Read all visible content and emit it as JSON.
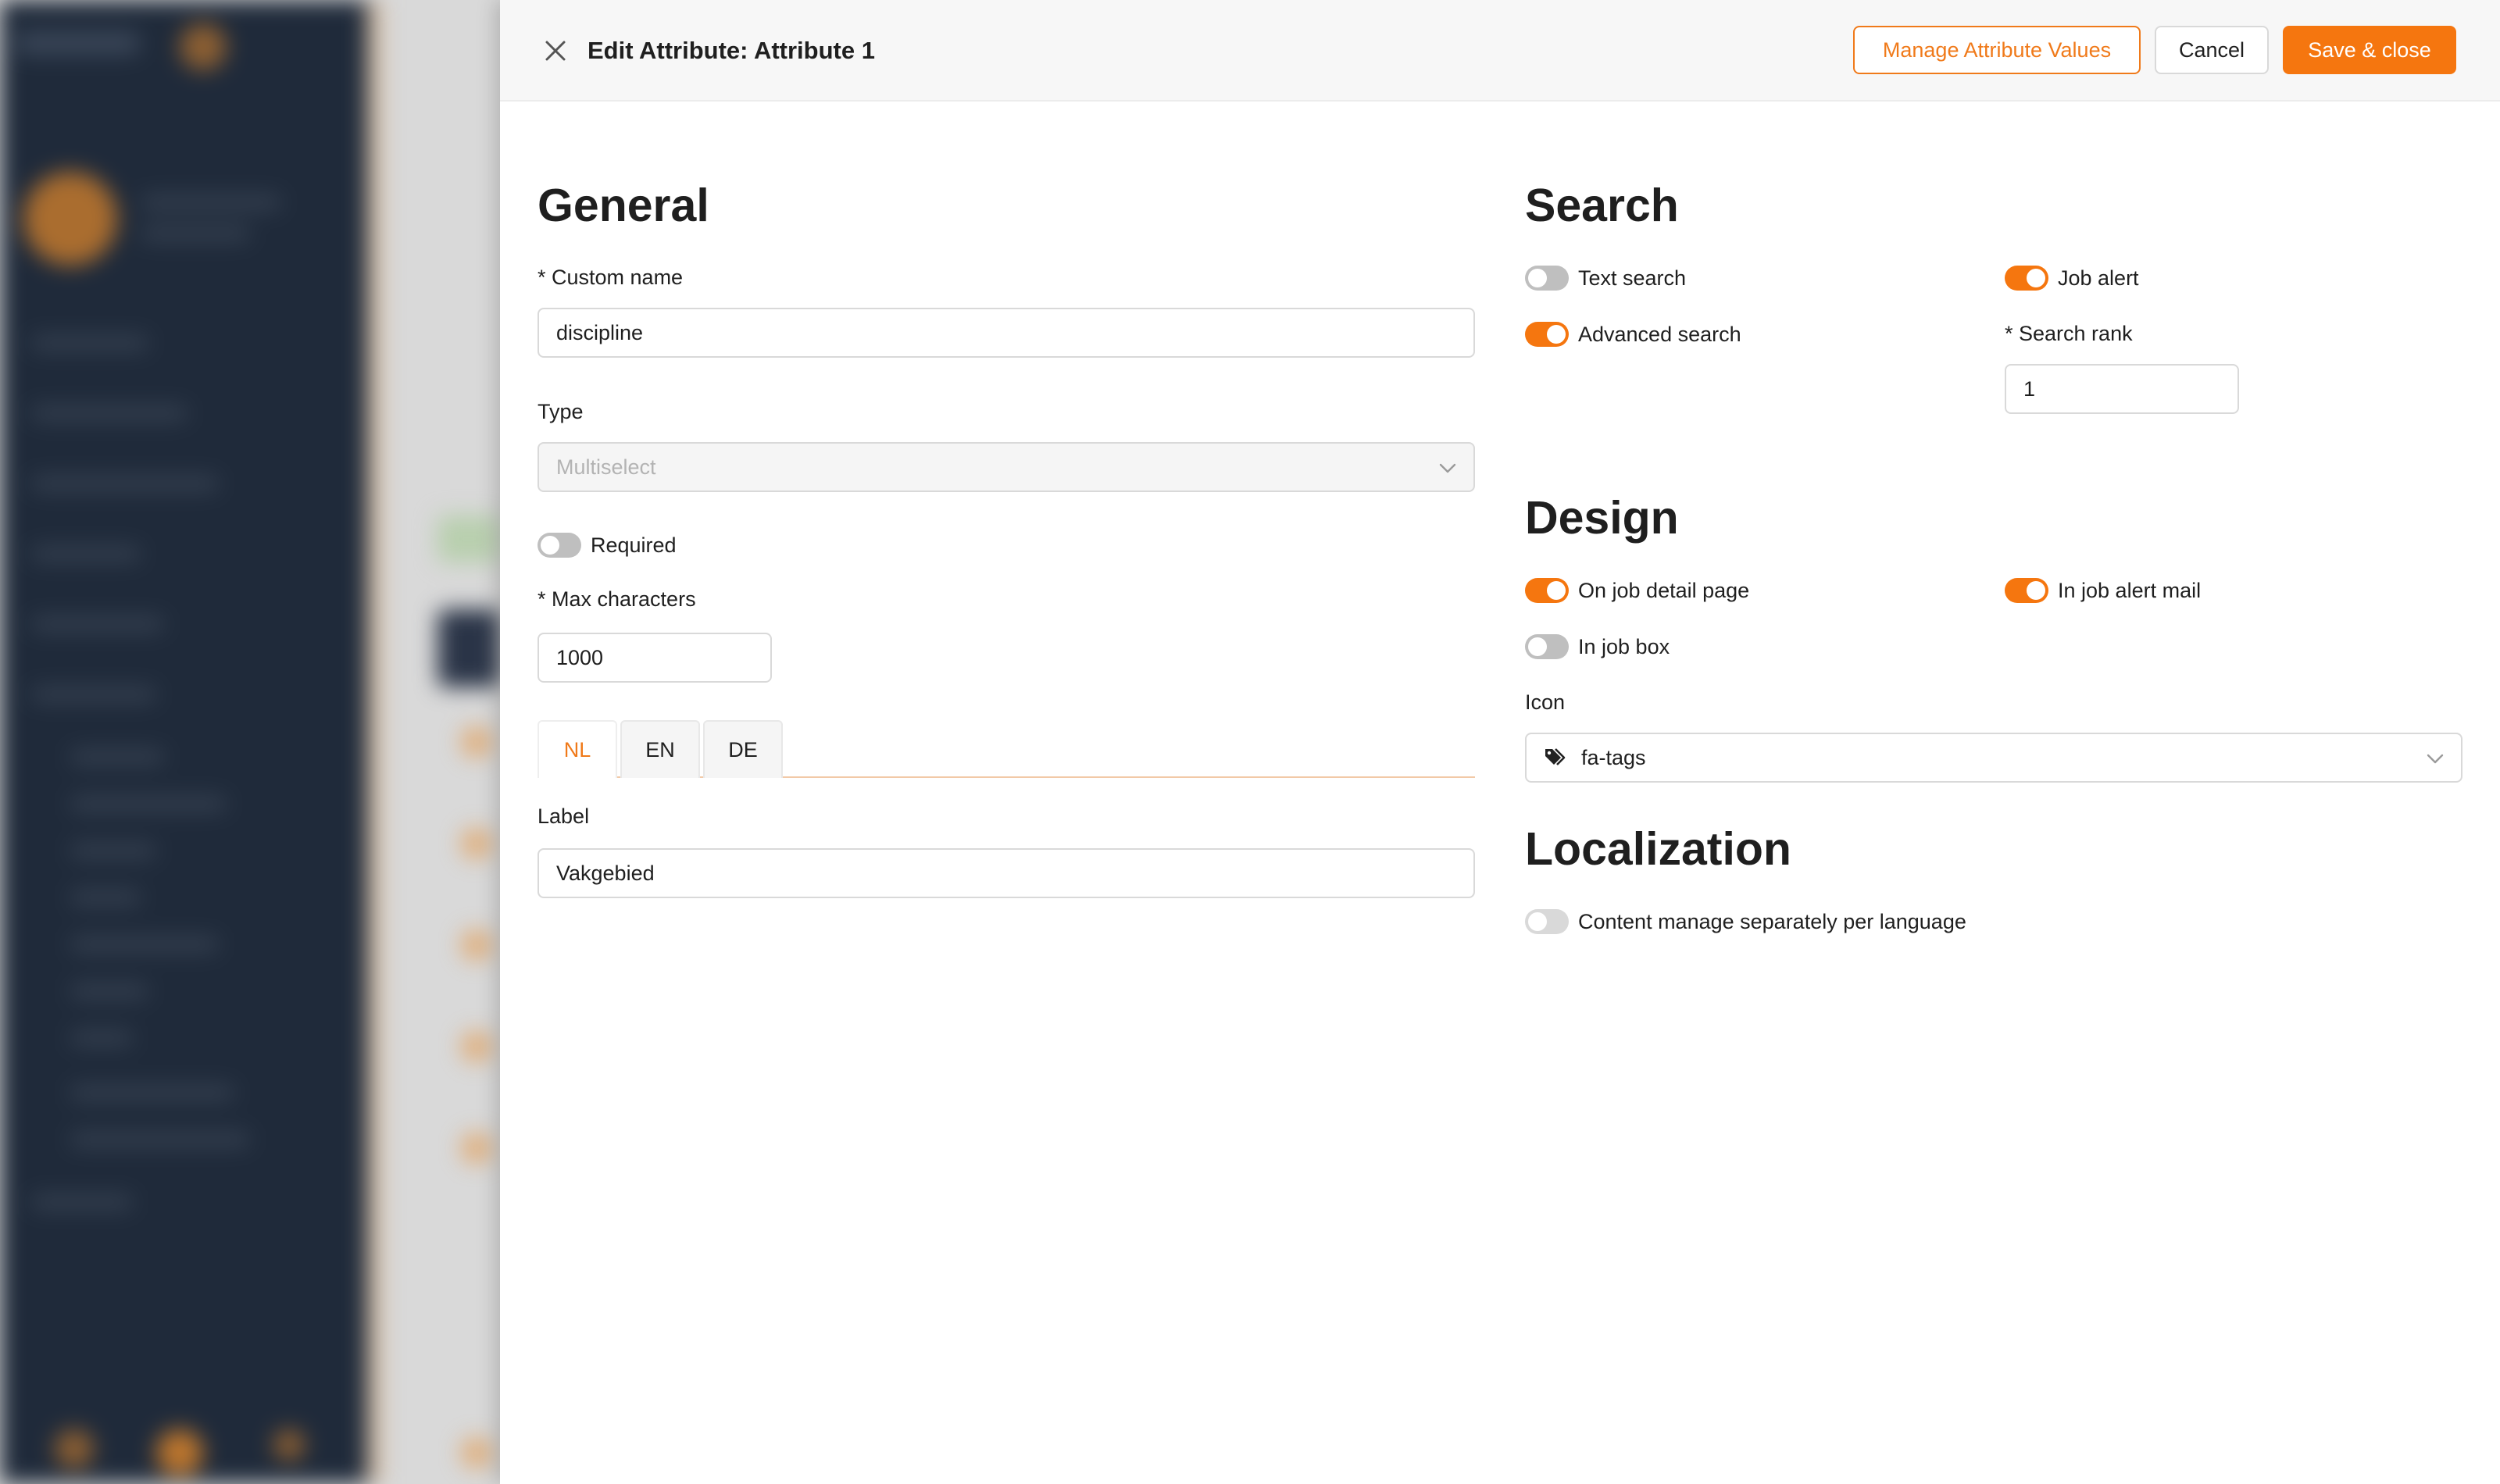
{
  "header": {
    "title": "Edit Attribute: Attribute 1",
    "manage_values_label": "Manage Attribute Values",
    "cancel_label": "Cancel",
    "save_label": "Save & close"
  },
  "general": {
    "title": "General",
    "custom_name": {
      "label": "* Custom name",
      "value": "discipline"
    },
    "type": {
      "label": "Type",
      "value": "Multiselect"
    },
    "required": {
      "label": "Required",
      "on": false
    },
    "max_characters": {
      "label": "* Max characters",
      "value": "1000"
    },
    "tabs": [
      {
        "label": "NL",
        "active": true
      },
      {
        "label": "EN",
        "active": false
      },
      {
        "label": "DE",
        "active": false
      }
    ],
    "label_field": {
      "label": "Label",
      "value": "Vakgebied"
    }
  },
  "search": {
    "title": "Search",
    "text_search": {
      "label": "Text search",
      "on": false
    },
    "job_alert": {
      "label": "Job alert",
      "on": true
    },
    "advanced_search": {
      "label": "Advanced search",
      "on": true
    },
    "search_rank": {
      "label": "* Search rank",
      "value": "1"
    }
  },
  "design": {
    "title": "Design",
    "on_job_detail_page": {
      "label": "On job detail page",
      "on": true
    },
    "in_job_alert_mail": {
      "label": "In job alert mail",
      "on": true
    },
    "in_job_box": {
      "label": "In job box",
      "on": false
    },
    "icon": {
      "label": "Icon",
      "value": "fa-tags"
    }
  },
  "localization": {
    "title": "Localization",
    "content_manage": {
      "label": "Content manage separately per language",
      "on": false
    }
  },
  "colors": {
    "accent": "#f5760f",
    "toggle_off": "#bfbfbf"
  }
}
